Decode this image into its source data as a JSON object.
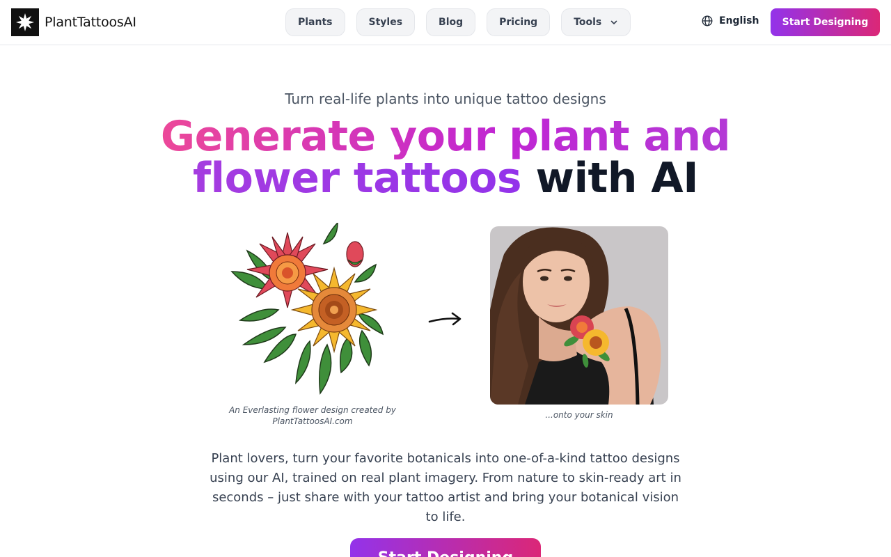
{
  "header": {
    "brand": "PlantTattoosAI",
    "nav": [
      {
        "label": "Plants"
      },
      {
        "label": "Styles"
      },
      {
        "label": "Blog"
      },
      {
        "label": "Pricing"
      },
      {
        "label": "Tools"
      }
    ],
    "language": "English",
    "cta": "Start Designing"
  },
  "hero": {
    "tagline": "Turn real-life plants into unique tattoo designs",
    "headline_part1": "Generate your plant and",
    "headline_part2": "flower tattoos",
    "headline_part3": "with AI",
    "caption_left": "An Everlasting flower design created by PlantTattoosAI.com",
    "caption_right": "...onto your skin",
    "description": "Plant lovers, turn your favorite botanicals into one-of-a-kind tattoo designs using our AI, trained on real plant imagery. From nature to skin-ready art in seconds – just share with your tattoo artist and bring your botanical vision to life.",
    "cta": "Start Designing"
  },
  "icons": {
    "logo": "starburst-logo-icon",
    "language": "globe-icon",
    "dropdown": "chevron-down-icon",
    "arrow": "arrow-right-icon"
  },
  "colors": {
    "accent_start": "#9333ea",
    "accent_end": "#db2777",
    "headline_pink": "#ec4899",
    "headline_purple": "#9333ea",
    "headline_dark": "#111827"
  }
}
